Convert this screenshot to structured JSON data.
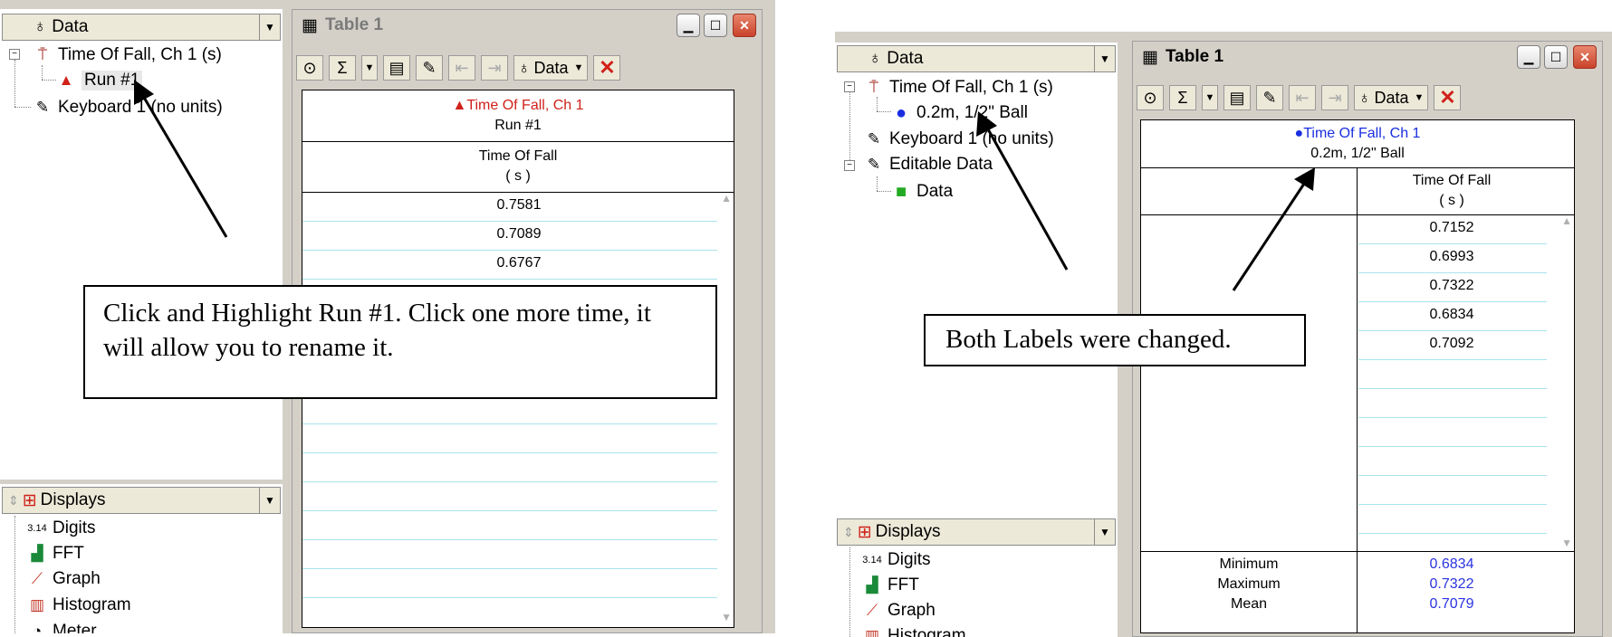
{
  "left": {
    "data_header": "Data",
    "tree": [
      {
        "label": "Time Of Fall, Ch 1 (s)",
        "icon": "sensor-icon"
      },
      {
        "label": "Run #1",
        "icon": "red-triangle-icon"
      },
      {
        "label": "Keyboard 1 (no units)",
        "icon": "pencil-icon"
      }
    ],
    "displays_header": "Displays",
    "displays": [
      {
        "label": "Digits",
        "glyph": "3.14"
      },
      {
        "label": "FFT"
      },
      {
        "label": "Graph"
      },
      {
        "label": "Histogram"
      },
      {
        "label": "Meter"
      }
    ],
    "window_title": "Table 1",
    "toolbar_data_label": "Data",
    "column_title": "Time Of Fall, Ch 1",
    "column_subtitle": "Run #1",
    "column_header": "Time Of Fall",
    "column_unit": "( s )",
    "values": [
      "0.7581",
      "0.7089",
      "0.6767"
    ],
    "callout": "Click and Highlight Run #1. Click one more time, it will allow you to rename it."
  },
  "right": {
    "data_header": "Data",
    "tree": [
      {
        "label": "Time Of Fall, Ch 1 (s)",
        "icon": "sensor-icon"
      },
      {
        "label": "0.2m, 1/2\" Ball",
        "icon": "blue-dot-icon"
      },
      {
        "label": "Keyboard 1 (no units)",
        "icon": "pencil-icon"
      },
      {
        "label": "Editable Data",
        "icon": "pencil-icon"
      },
      {
        "label": "Data",
        "icon": "green-square-icon"
      }
    ],
    "displays_header": "Displays",
    "displays": [
      {
        "label": "Digits",
        "glyph": "3.14"
      },
      {
        "label": "FFT"
      },
      {
        "label": "Graph"
      },
      {
        "label": "Histogram"
      }
    ],
    "window_title": "Table 1",
    "toolbar_data_label": "Data",
    "column_title": "Time Of Fall, Ch 1",
    "column_subtitle": "0.2m, 1/2\" Ball",
    "column_header": "Time Of Fall",
    "column_unit": "( s )",
    "values": [
      "0.7152",
      "0.6993",
      "0.7322",
      "0.6834",
      "0.7092"
    ],
    "stats": [
      {
        "label": "Minimum",
        "value": "0.6834"
      },
      {
        "label": "Maximum",
        "value": "0.7322"
      },
      {
        "label": "Mean",
        "value": "0.7079"
      }
    ],
    "callout": "Both Labels were changed."
  },
  "colors": {
    "red": "#d0211a",
    "blue": "#1a2ee0",
    "green": "#22aa22",
    "stat_blue": "#2a33e0"
  }
}
